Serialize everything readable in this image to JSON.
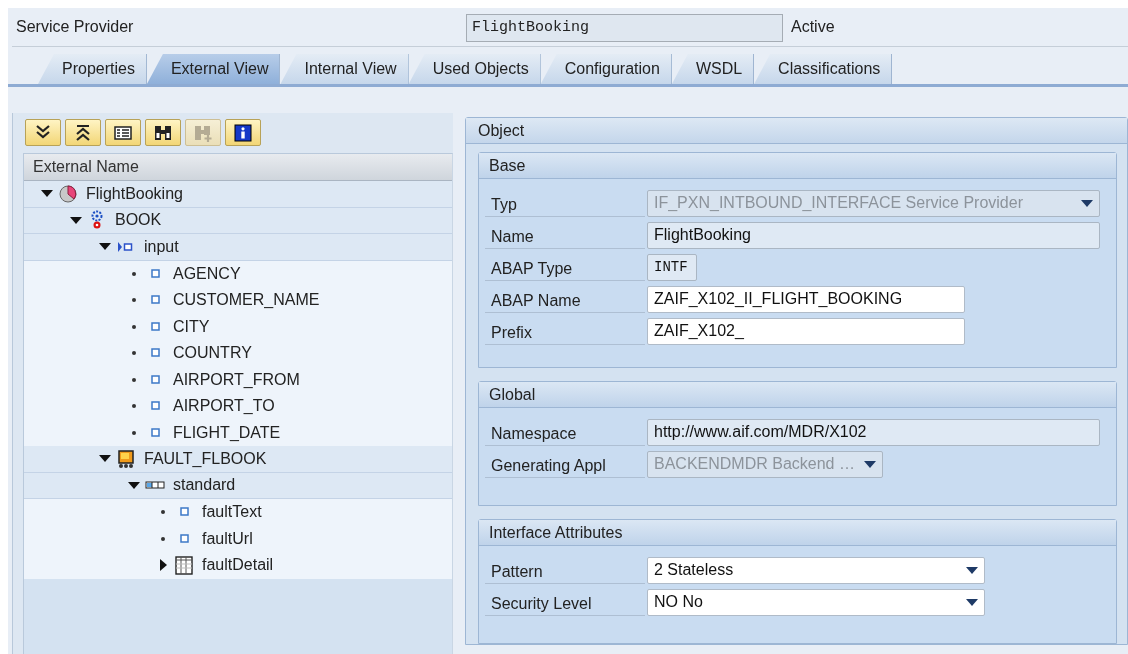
{
  "header": {
    "label": "Service Provider",
    "name": "FlightBooking",
    "status": "Active"
  },
  "tabs": [
    {
      "label": "Properties",
      "selected": false
    },
    {
      "label": "External View",
      "selected": true
    },
    {
      "label": "Internal View",
      "selected": false
    },
    {
      "label": "Used Objects",
      "selected": false
    },
    {
      "label": "Configuration",
      "selected": false
    },
    {
      "label": "WSDL",
      "selected": false
    },
    {
      "label": "Classifications",
      "selected": false
    }
  ],
  "toolbar": [
    {
      "kind": "expand_all",
      "disabled": false
    },
    {
      "kind": "collapse_all",
      "disabled": false
    },
    {
      "kind": "details",
      "disabled": false
    },
    {
      "kind": "find",
      "disabled": false
    },
    {
      "kind": "find_next",
      "disabled": true
    },
    {
      "kind": "info",
      "disabled": false
    }
  ],
  "tree": {
    "column": "External Name",
    "nodes": [
      {
        "label": "FlightBooking",
        "kind": "interface",
        "expanded": true,
        "children": [
          {
            "label": "BOOK",
            "kind": "operation",
            "expanded": true,
            "children": [
              {
                "label": "input",
                "kind": "message",
                "expanded": true,
                "children": [
                  {
                    "label": "AGENCY",
                    "kind": "field"
                  },
                  {
                    "label": "CUSTOMER_NAME",
                    "kind": "field"
                  },
                  {
                    "label": "CITY",
                    "kind": "field"
                  },
                  {
                    "label": "COUNTRY",
                    "kind": "field"
                  },
                  {
                    "label": "AIRPORT_FROM",
                    "kind": "field"
                  },
                  {
                    "label": "AIRPORT_TO",
                    "kind": "field"
                  },
                  {
                    "label": "FLIGHT_DATE",
                    "kind": "field"
                  }
                ]
              },
              {
                "label": "FAULT_FLBOOK",
                "kind": "fault",
                "expanded": true,
                "children": [
                  {
                    "label": "standard",
                    "kind": "structure",
                    "expanded": true,
                    "children": [
                      {
                        "label": "faultText",
                        "kind": "field"
                      },
                      {
                        "label": "faultUrl",
                        "kind": "field"
                      },
                      {
                        "label": "faultDetail",
                        "kind": "table",
                        "expanded": false
                      }
                    ]
                  }
                ]
              }
            ]
          }
        ]
      }
    ]
  },
  "object": {
    "title": "Object",
    "groups": [
      {
        "title": "Base",
        "fields": [
          {
            "label": "Typ",
            "value": "IF_PXN_INTBOUND_INTERFACE Service Provider",
            "kind": "dropdown",
            "editable": false,
            "disabled": true
          },
          {
            "label": "Name",
            "value": "FlightBooking",
            "kind": "input",
            "editable": false,
            "disabled": false
          },
          {
            "label": "ABAP Type",
            "value": "INTF",
            "kind": "code",
            "editable": false,
            "disabled": false
          },
          {
            "label": "ABAP Name",
            "value": "ZAIF_X102_II_FLIGHT_BOOKING",
            "kind": "input",
            "editable": true,
            "disabled": false
          },
          {
            "label": "Prefix",
            "value": "ZAIF_X102_",
            "kind": "input",
            "editable": true,
            "disabled": false
          }
        ]
      },
      {
        "title": "Global",
        "fields": [
          {
            "label": "Namespace",
            "value": "http://www.aif.com/MDR/X102",
            "kind": "input",
            "editable": false,
            "disabled": false
          },
          {
            "label": "Generating Appl",
            "value": "BACKENDMDR Backend …",
            "kind": "dropdown",
            "editable": false,
            "disabled": true
          }
        ]
      },
      {
        "title": "Interface Attributes",
        "fields": [
          {
            "label": "Pattern",
            "value": "2 Stateless",
            "kind": "dropdown",
            "editable": true,
            "disabled": false
          },
          {
            "label": "Security Level",
            "value": "NO No",
            "kind": "dropdown",
            "editable": true,
            "disabled": false
          }
        ]
      }
    ]
  }
}
